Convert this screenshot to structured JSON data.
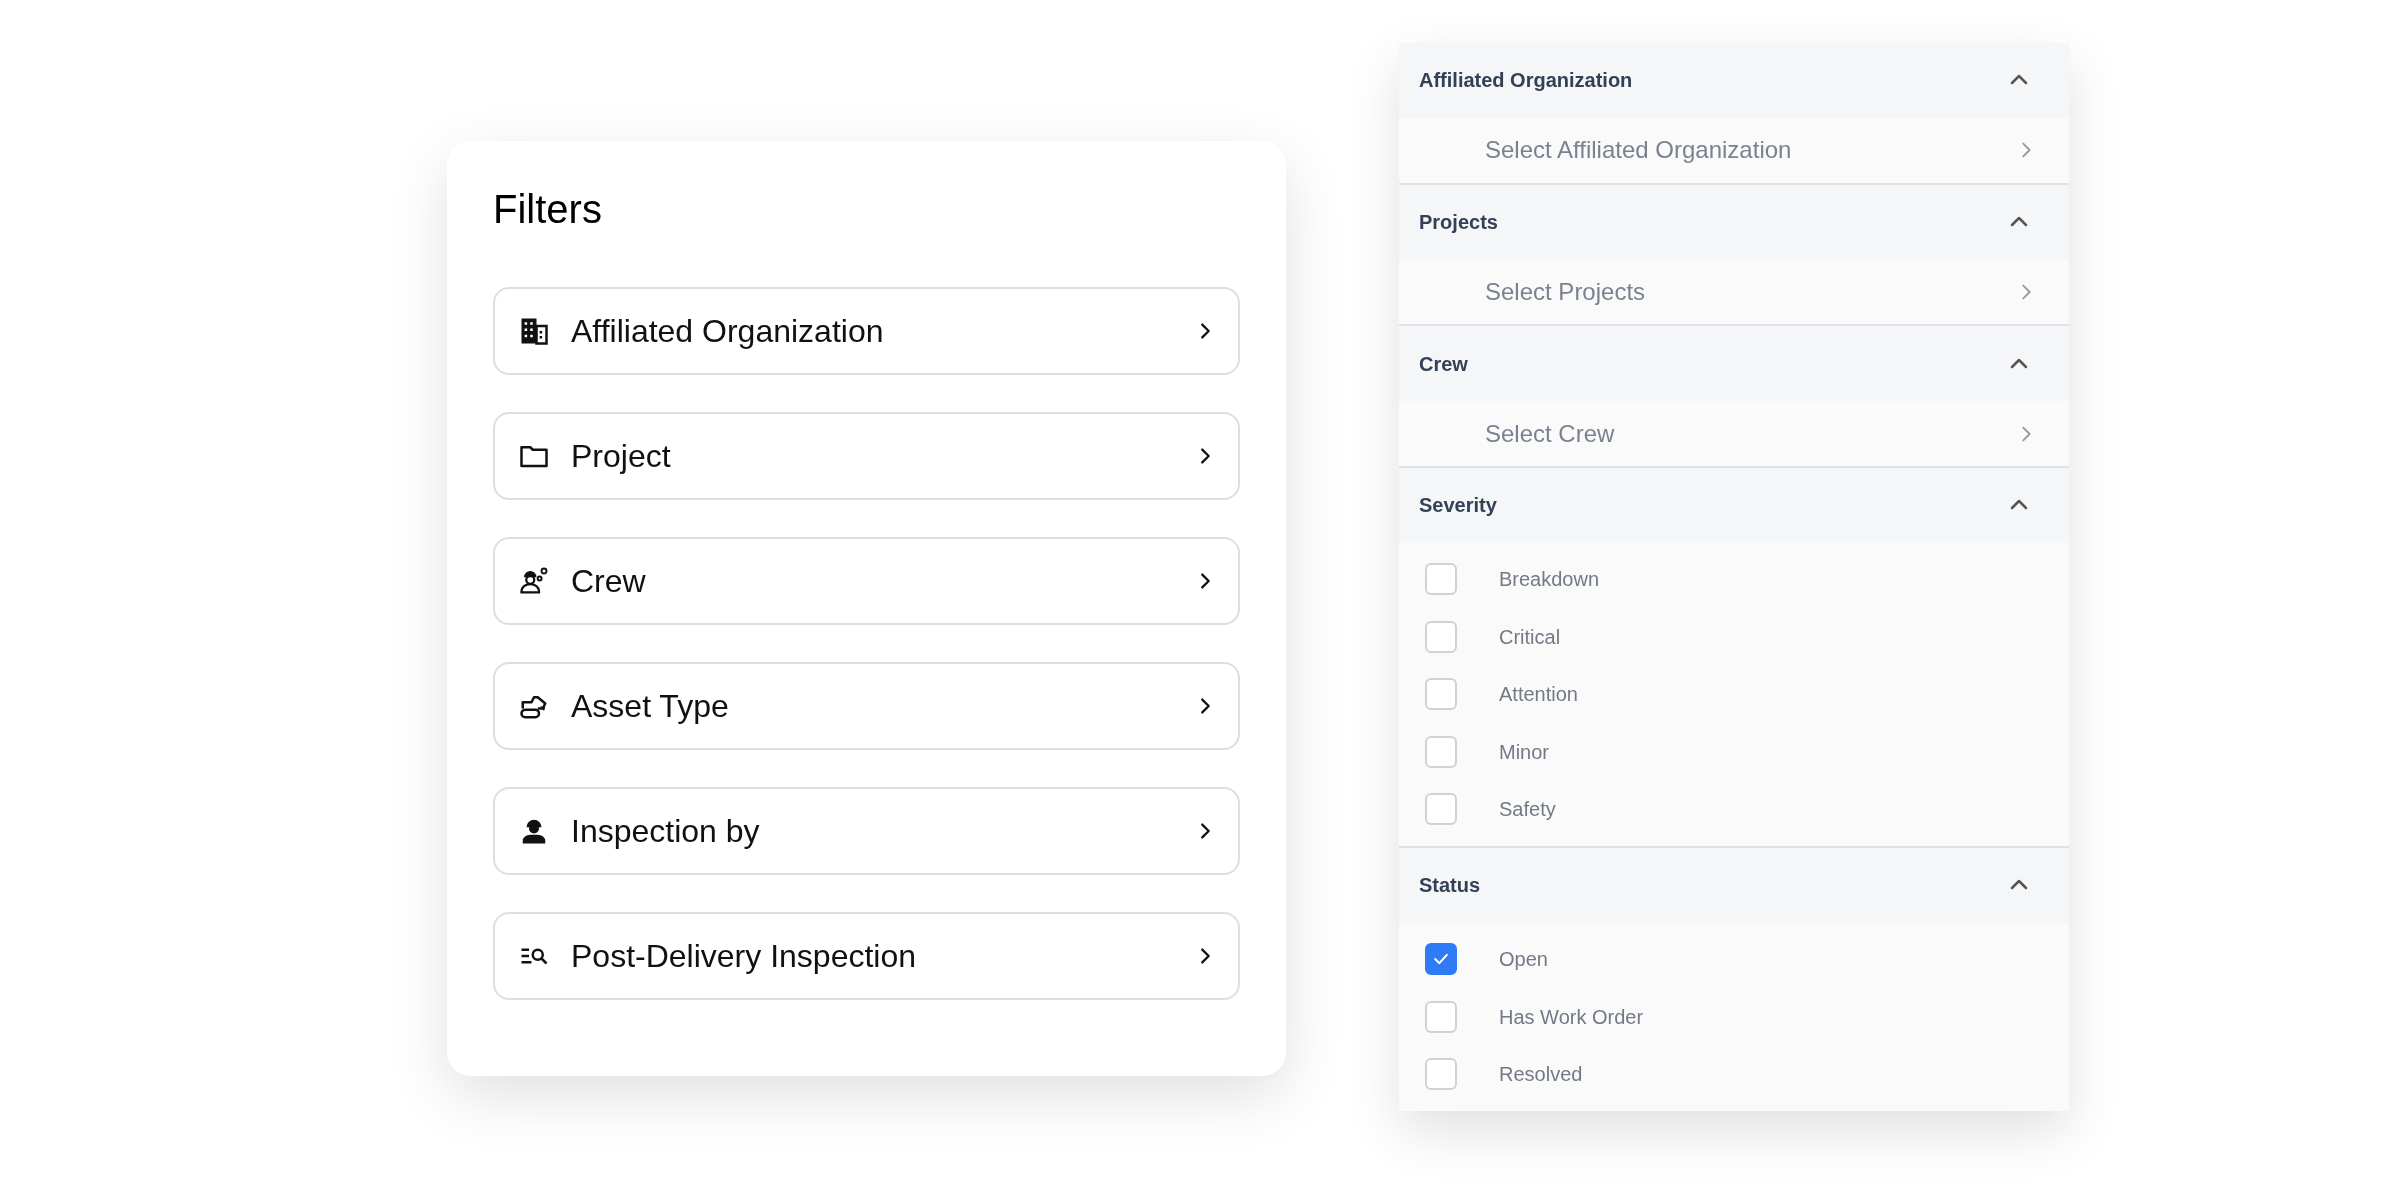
{
  "filters_card": {
    "title": "Filters",
    "items": [
      {
        "label": "Affiliated Organization"
      },
      {
        "label": "Project"
      },
      {
        "label": "Crew"
      },
      {
        "label": "Asset Type"
      },
      {
        "label": "Inspection by"
      },
      {
        "label": "Post-Delivery Inspection"
      }
    ]
  },
  "filter_panel": {
    "sections": [
      {
        "title": "Affiliated Organization",
        "expanded": true,
        "kind": "select",
        "placeholder": "Select Affiliated Organization"
      },
      {
        "title": "Projects",
        "expanded": true,
        "kind": "select",
        "placeholder": "Select Projects"
      },
      {
        "title": "Crew",
        "expanded": true,
        "kind": "select",
        "placeholder": "Select Crew"
      },
      {
        "title": "Severity",
        "expanded": true,
        "kind": "checklist",
        "options": [
          {
            "label": "Breakdown",
            "checked": false
          },
          {
            "label": "Critical",
            "checked": false
          },
          {
            "label": "Attention",
            "checked": false
          },
          {
            "label": "Minor",
            "checked": false
          },
          {
            "label": "Safety",
            "checked": false
          }
        ]
      },
      {
        "title": "Status",
        "expanded": true,
        "kind": "checklist",
        "options": [
          {
            "label": "Open",
            "checked": true
          },
          {
            "label": "Has Work Order",
            "checked": false
          },
          {
            "label": "Resolved",
            "checked": false
          }
        ]
      }
    ]
  }
}
